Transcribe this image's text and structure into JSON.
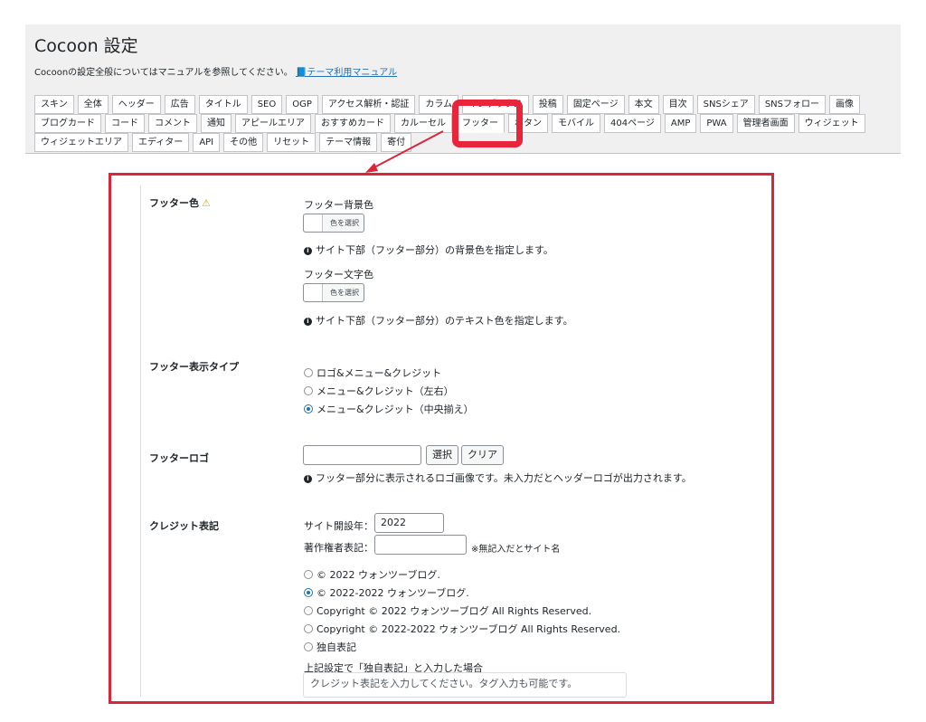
{
  "header": {
    "title": "Cocoon 設定",
    "intro": "Cocoonの設定全般についてはマニュアルを参照してください。",
    "manual_link": "テーマ利用マニュアル"
  },
  "tabs": {
    "row1": [
      "スキン",
      "全体",
      "ヘッダー",
      "広告",
      "タイトル",
      "SEO",
      "OGP",
      "アクセス解析・認証",
      "カラム",
      "インデックス",
      "投稿",
      "固定ページ",
      "本文",
      "目次",
      "SNSシェア",
      "SNSフォロー",
      "画像"
    ],
    "row2": [
      "ブログカード",
      "コード",
      "コメント",
      "通知",
      "アピールエリア",
      "おすすめカード",
      "カルーセル",
      "フッター",
      "ボタン",
      "モバイル",
      "404ページ",
      "AMP",
      "PWA",
      "管理者画面",
      "ウィジェット"
    ],
    "row3": [
      "ウィジェットエリア",
      "エディター",
      "API",
      "その他",
      "リセット",
      "テーマ情報",
      "寄付"
    ],
    "active": "フッター"
  },
  "footer_color": {
    "label": "フッター色",
    "bg_label": "フッター背景色",
    "bg_button": "色を選択",
    "bg_help": "サイト下部（フッター部分）の背景色を指定します。",
    "text_label": "フッター文字色",
    "text_button": "色を選択",
    "text_help": "サイト下部（フッター部分）のテキスト色を指定します。"
  },
  "display_type": {
    "label": "フッター表示タイプ",
    "options": [
      "ロゴ&メニュー&クレジット",
      "メニュー&クレジット（左右）",
      "メニュー&クレジット（中央揃え）"
    ],
    "selected_index": 2
  },
  "footer_logo": {
    "label": "フッターロゴ",
    "select_button": "選択",
    "clear_button": "クリア",
    "help": "フッター部分に表示されるロゴ画像です。未入力だとヘッダーロゴが出力されます。"
  },
  "credit": {
    "label": "クレジット表記",
    "year_label": "サイト開設年：",
    "year_value": "2022",
    "author_label": "著作権者表記：",
    "author_value": "",
    "author_note": "※無記入だとサイト名",
    "options": [
      "© 2022 ウォンツーブログ.",
      "© 2022-2022 ウォンツーブログ.",
      "Copyright © 2022 ウォンツーブログ All Rights Reserved.",
      "Copyright © 2022-2022 ウォンツーブログ All Rights Reserved.",
      "独自表記"
    ],
    "selected_index": 1,
    "custom_label": "上記設定で「独自表記」と入力した場合",
    "custom_placeholder": "クレジット表記を入力してください。タグ入力も可能です。"
  },
  "colors": {
    "highlight": "#e8253a",
    "link": "#2271b1",
    "warning": "#dba617"
  }
}
